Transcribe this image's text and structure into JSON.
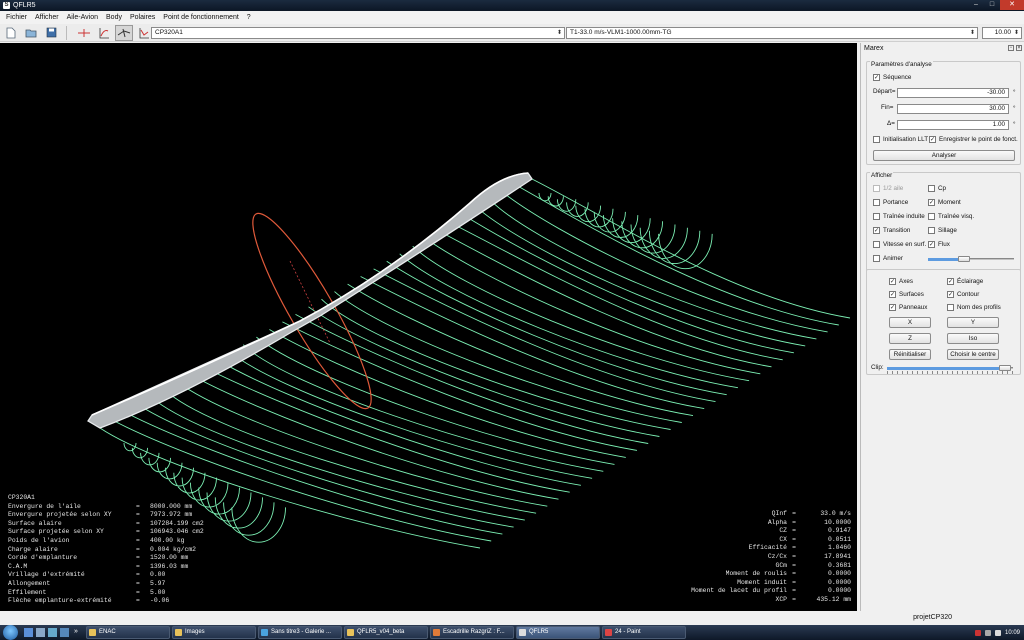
{
  "window": {
    "title": "QFLR5",
    "buttons": {
      "minimize": "–",
      "maximize": "□",
      "close": "✕"
    }
  },
  "menubar": [
    "Fichier",
    "Afficher",
    "Aile-Avion",
    "Body",
    "Polaires",
    "Point de fonctionnement",
    "?"
  ],
  "toolbar": {
    "icons": [
      "new-file-icon",
      "open-file-icon",
      "save-icon",
      "wing-view-icon",
      "polar-view-icon",
      "3d-view-icon",
      "opp-view-icon"
    ],
    "plane_combo": "CP320A1",
    "polar_combo": "T1-33.0 m/s-VLM1-1000.00mm-TG",
    "alpha_combo": "10.00"
  },
  "info_left": {
    "title": "CP320A1",
    "rows": [
      {
        "label": "Envergure de l'aile",
        "value": "8000.000 mm"
      },
      {
        "label": "Envergure projetée selon XY",
        "value": "7973.972 mm"
      },
      {
        "label": "Surface alaire",
        "value": "107284.199 cm2"
      },
      {
        "label": "Surface projetée selon XY",
        "value": "106943.046 cm2"
      },
      {
        "label": "Poids de l'avion",
        "value": "400.00 kg"
      },
      {
        "label": "Charge alaire",
        "value": "0.004 kg/cm2"
      },
      {
        "label": "Corde d'emplanture",
        "value": "1520.00 mm"
      },
      {
        "label": "C.A.M",
        "value": "1396.03 mm"
      },
      {
        "label": "Vrillage d'extrémité",
        "value": "0.00"
      },
      {
        "label": "Allongement",
        "value": "5.97"
      },
      {
        "label": "Effilement",
        "value": "5.00"
      },
      {
        "label": "Flèche emplanture-extrémité",
        "value": "-0.06"
      }
    ]
  },
  "info_right": {
    "rows": [
      {
        "label": "QInf",
        "value": "33.0 m/s"
      },
      {
        "label": "Alpha",
        "value": "10.0000"
      },
      {
        "label": "CZ",
        "value": "0.9147"
      },
      {
        "label": "CX",
        "value": "0.0511"
      },
      {
        "label": "Efficacité",
        "value": "1.0460"
      },
      {
        "label": "Cz/Cx",
        "value": "17.8941"
      },
      {
        "label": "GCm",
        "value": "0.3681"
      },
      {
        "label": "Moment de roulis",
        "value": "0.0000"
      },
      {
        "label": "Moment induit",
        "value": "0.0000"
      },
      {
        "label": "Moment de lacet du profil",
        "value": "0.0000"
      },
      {
        "label": "XCP",
        "value": "435.12 mm"
      }
    ]
  },
  "panel": {
    "title": "Marex",
    "analysis": {
      "title": "Paramètres d'analyse",
      "sequence_label": "Séquence",
      "sequence_checked": "✓",
      "depart_label": "Départ=",
      "depart_value": "-30.00",
      "fin_label": "Fin=",
      "fin_value": "30.00",
      "delta_label": "Δ=",
      "delta_value": "1.00",
      "unit": "°",
      "init_llt_label": "Initialisation LLT",
      "store_label": "Enregistrer le point de fonct.",
      "store_checked": "✓",
      "analyze_button": "Analyser"
    },
    "display": {
      "title": "Afficher",
      "half_wing": "1/2 aile",
      "cp": "Cp",
      "lift": "Portance",
      "moment": "Moment",
      "induced_drag": "Traînée induite",
      "viscous_drag": "Traînée visq.",
      "transition": "Transition",
      "wake": "Sillage",
      "surface_velocity": "Vitesse en surf.",
      "flow": "Flux",
      "animate": "Animer",
      "check": "✓",
      "animation_speed": 0.42
    },
    "view": {
      "axes": "Axes",
      "lighting": "Éclairage",
      "surfaces": "Surfaces",
      "outline": "Contour",
      "panels": "Panneaux",
      "foil_names": "Nom des profils",
      "check": "✓",
      "x_button": "X",
      "y_button": "Y",
      "z_button": "Z",
      "iso_button": "Iso",
      "reset_button": "Réinitialiser",
      "center_button": "Choisir le centre",
      "clip_label": "Clip:",
      "clip_level": 0.94
    }
  },
  "status": {
    "project": "projetCP320"
  },
  "taskbar": {
    "tasks": [
      {
        "label": "ENAC",
        "color": "#e8c25a"
      },
      {
        "label": "Images",
        "color": "#e8c25a"
      },
      {
        "label": "Sans titre3 - Galerie ...",
        "color": "#4aa3df"
      },
      {
        "label": "QFLR5_v04_beta",
        "color": "#e8c25a"
      },
      {
        "label": "Escadrille RazgriZ : F...",
        "color": "#e07b39"
      },
      {
        "label": "QFLR5",
        "color": "#dddddd"
      },
      {
        "label": "24 - Paint",
        "color": "#d44"
      }
    ],
    "overflow": "»",
    "clock": "10:09"
  }
}
